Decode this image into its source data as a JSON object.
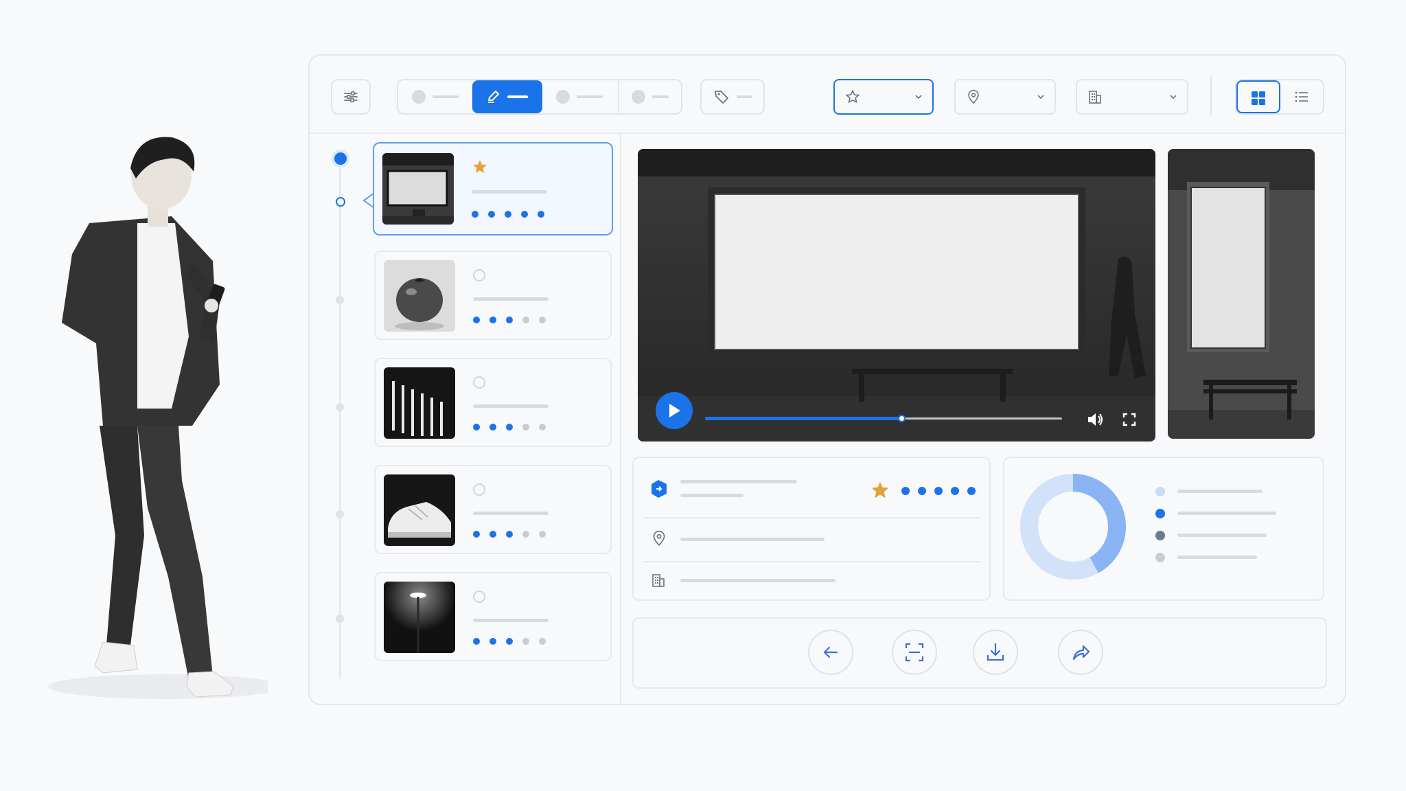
{
  "toolbar": {
    "filter_icon": "sliders-icon",
    "modes": [
      {
        "icon": "dot",
        "active": false
      },
      {
        "icon": "pencil-icon",
        "active": true
      },
      {
        "icon": "dot",
        "active": false
      },
      {
        "icon": "dot",
        "active": false
      }
    ],
    "tag_icon": "tag-icon",
    "dropdowns": [
      {
        "icon": "star-icon",
        "active": true
      },
      {
        "icon": "map-pin-icon",
        "active": false
      },
      {
        "icon": "building-icon",
        "active": false
      }
    ],
    "view": {
      "active": "grid"
    }
  },
  "list": [
    {
      "thumb": "billboard",
      "starred": true,
      "rating": 5,
      "selected": true
    },
    {
      "thumb": "tomato",
      "starred": false,
      "rating": 3,
      "selected": false
    },
    {
      "thumb": "stripes",
      "starred": false,
      "rating": 3,
      "selected": false
    },
    {
      "thumb": "sneaker",
      "starred": false,
      "rating": 3,
      "selected": false
    },
    {
      "thumb": "lamp",
      "starred": false,
      "rating": 3,
      "selected": false
    }
  ],
  "video": {
    "progress": 0.55,
    "playing": false
  },
  "details": {
    "rating": 5,
    "rows": [
      "tag-icon",
      "map-pin-icon",
      "building-icon"
    ]
  },
  "donut": {
    "segments": [
      0.42,
      0.58
    ]
  },
  "legend_colors": [
    "#c8dcf7",
    "#1a73e8",
    "#6b7a8c",
    "#c7ccd3"
  ],
  "colors": {
    "accent": "#1a73e8",
    "star": "#e2a23b"
  },
  "actions": [
    "arrow-left-icon",
    "scan-icon",
    "download-icon",
    "share-icon"
  ]
}
